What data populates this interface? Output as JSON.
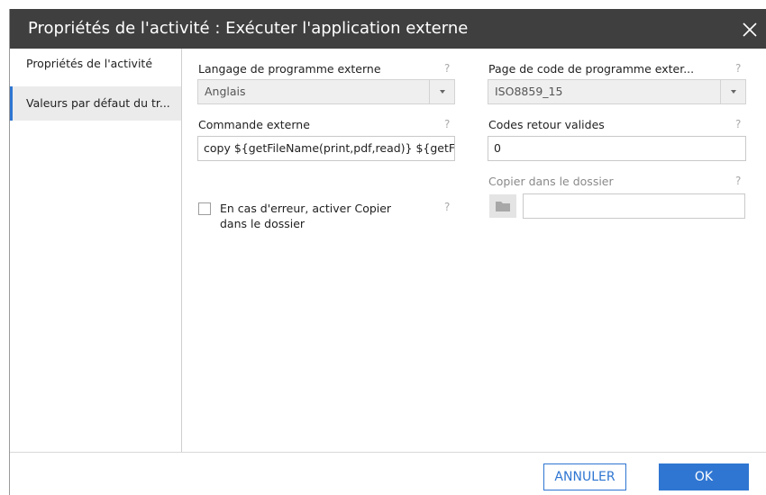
{
  "dialog": {
    "title": "Propriétés de l'activité : Exécuter l'application externe"
  },
  "sidebar": {
    "items": [
      {
        "label": "Propriétés de l'activité",
        "selected": false
      },
      {
        "label": "Valeurs par défaut du tr...",
        "selected": true
      }
    ]
  },
  "form": {
    "language": {
      "label": "Langage de programme externe",
      "value": "Anglais",
      "help": "?"
    },
    "codepage": {
      "label": "Page de code de programme exter...",
      "value": "ISO8859_15",
      "help": "?"
    },
    "command": {
      "label": "Commande externe",
      "value": "copy ${getFileName(print,pdf,read)} ${getFileNam",
      "help": "?"
    },
    "return_codes": {
      "label": "Codes retour valides",
      "value": "0",
      "help": "?"
    },
    "copy_to_folder": {
      "label": "Copier dans le dossier",
      "value": "",
      "help": "?",
      "disabled": true
    },
    "on_error": {
      "label_line1": "En cas d'erreur, activer Copier",
      "label_line2": "dans le dossier",
      "checked": false,
      "help": "?"
    }
  },
  "footer": {
    "cancel_label": "ANNULER",
    "ok_label": "OK"
  },
  "colors": {
    "titlebar": "#3f3f3f",
    "accent": "#2f76d2"
  },
  "icons": {
    "close": "close-icon",
    "folder": "folder-icon",
    "dropdown": "chevron-down-icon"
  }
}
